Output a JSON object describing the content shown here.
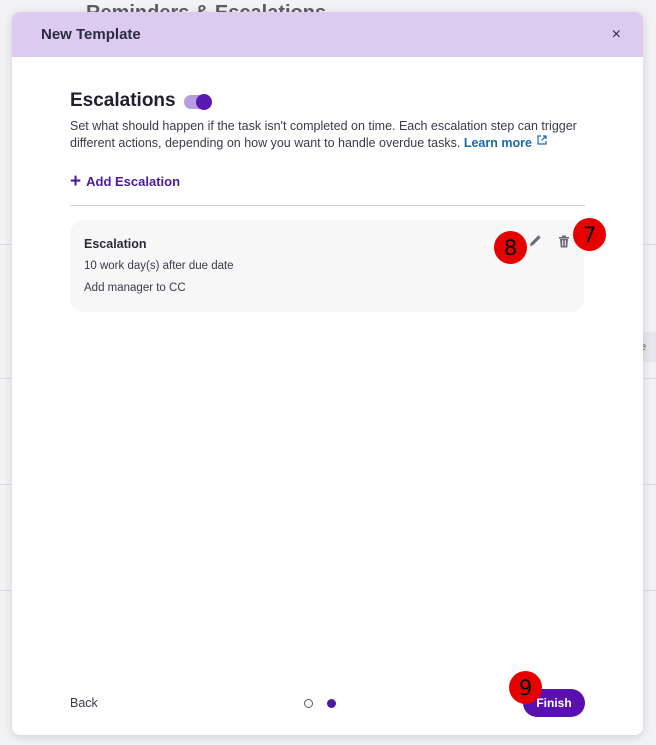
{
  "background": {
    "title": "Reminders & Escalations"
  },
  "modal": {
    "title": "New Template",
    "close_icon": "×"
  },
  "section": {
    "heading": "Escalations",
    "toggle_on": true,
    "description": "Set what should happen if the task isn't completed on time. Each escalation step can trigger different actions, depending on how you want to handle overdue tasks.",
    "learn_more": "Learn more"
  },
  "add_escalation": {
    "plus": "+",
    "label": "Add Escalation"
  },
  "escalation_card": {
    "title": "Escalation",
    "timing": "10 work day(s) after due date",
    "action": "Add manager to CC"
  },
  "footer": {
    "back": "Back",
    "finish": "Finish",
    "steps_total": 2,
    "current_step": 2
  },
  "badges": {
    "edit": "8",
    "delete": "7",
    "finish": "9"
  },
  "colors": {
    "header_bg": "#dccaf0",
    "accent": "#5a0fb0",
    "link": "#1a6aa8",
    "badge": "#e60000"
  }
}
